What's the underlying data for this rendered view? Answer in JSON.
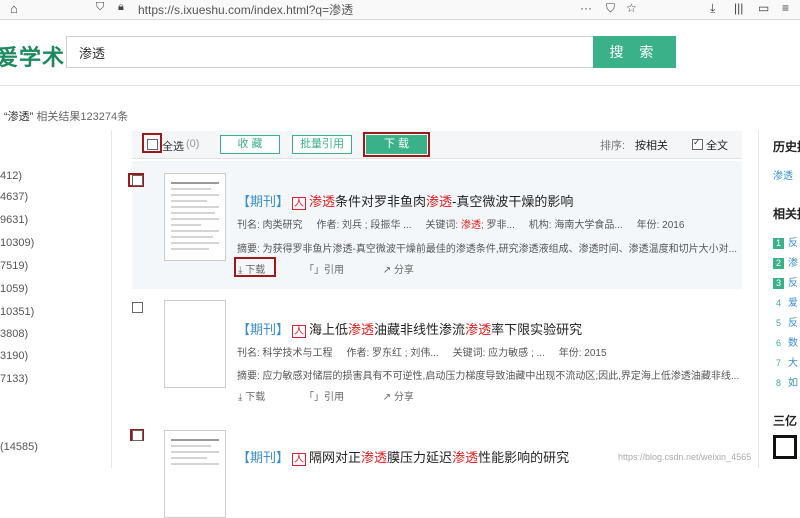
{
  "browser": {
    "url": "https://s.ixueshu.com/index.html?q=渗透",
    "icons": [
      "home-icon",
      "shield-icon",
      "lock-icon",
      "download-icon",
      "library-icon",
      "reader-icon",
      "menu-icon"
    ]
  },
  "header": {
    "logo_text": "爱学术",
    "logo_visible": "爰学术",
    "search_value": "渗透",
    "search_button": "搜 索"
  },
  "count": {
    "keyword": "“渗透”",
    "label": "相关结果123274条"
  },
  "facets": [
    "412)",
    "4637)",
    "9631)",
    "10309)",
    "7519)",
    "1059)",
    "10351)",
    "3808)",
    "3190)",
    "7133)",
    "(14585)"
  ],
  "toolbar": {
    "select_all": "全选",
    "selected_count": "(0)",
    "favorite": "收 藏",
    "batch_cite": "批量引用",
    "download": "下 载",
    "sort_label": "排序:",
    "sort_value": "按相关",
    "fulltext": "全文"
  },
  "results": [
    {
      "tag": "【期刊】",
      "pdf": "人",
      "title_parts": [
        "渗透",
        "条件对罗非鱼肉",
        "渗透",
        "-真空微波干燥的影响"
      ],
      "journal_label": "刊名: 肉类研究",
      "author_label": "作者: 刘兵 ; 段振华 ...",
      "keywords_label": "关键词:",
      "keywords_hl": "渗透",
      "keywords_rest": "; 罗非...",
      "org_label": "机构: 海南大学食品...",
      "year_label": "年份: 2016",
      "abstract": "摘要: 为获得罗非鱼片渗透-真空微波干燥前最佳的渗透条件,研究渗透液组成、渗透时间、渗透温度和切片大小对...",
      "download": "下载",
      "cite": "引用",
      "share": "分享"
    },
    {
      "tag": "【期刊】",
      "pdf": "人",
      "title_parts": [
        "海上低",
        "渗透",
        "油藏非线性渗流",
        "渗透",
        "率下限实验研究"
      ],
      "journal_label": "刊名: 科学技术与工程",
      "author_label": "作者: 罗东红 ; 刘伟...",
      "keywords_label": "关键词:",
      "keywords_hl": "应力敏感 ; ...",
      "year_label": "年份: 2015",
      "abstract": "摘要: 应力敏感对储层的损害具有不可逆性,启动压力梯度导致油藏中出现不流动区;因此,界定海上低渗透油藏非线...",
      "download": "下载",
      "cite": "引用",
      "share": "分享"
    },
    {
      "tag": "【期刊】",
      "pdf": "人",
      "title_parts": [
        "隔网对正",
        "渗透",
        "膜压力延迟",
        "渗透",
        "性能影响的研究"
      ]
    }
  ],
  "right_panel": {
    "history_title": "历史搜",
    "history_item": "渗透",
    "related_title": "相关推",
    "ranks": [
      {
        "num": "1",
        "text": "反"
      },
      {
        "num": "2",
        "text": "渗"
      },
      {
        "num": "3",
        "text": "反"
      },
      {
        "num": "4",
        "text": "爱"
      },
      {
        "num": "5",
        "text": "反"
      },
      {
        "num": "6",
        "text": "数"
      },
      {
        "num": "7",
        "text": "大"
      },
      {
        "num": "8",
        "text": "如"
      }
    ],
    "bottom_title": "三亿"
  },
  "watermark": "https://blog.csdn.net/weixin_4565"
}
